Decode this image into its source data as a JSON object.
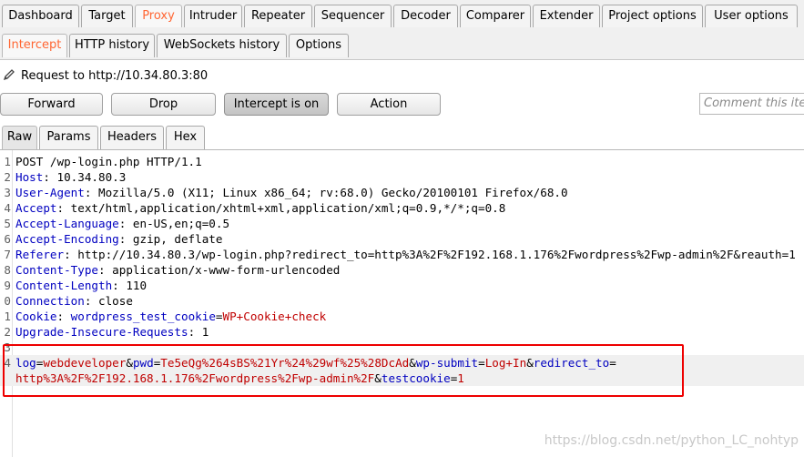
{
  "main_tabs": [
    "Dashboard",
    "Target",
    "Proxy",
    "Intruder",
    "Repeater",
    "Sequencer",
    "Decoder",
    "Comparer",
    "Extender",
    "Project options",
    "User options"
  ],
  "sub_tabs": [
    "Intercept",
    "HTTP history",
    "WebSockets history",
    "Options"
  ],
  "request_to": "Request to http://10.34.80.3:80",
  "buttons": {
    "forward": "Forward",
    "drop": "Drop",
    "intercept": "Intercept is on",
    "action": "Action"
  },
  "comment_placeholder": "Comment this item",
  "view_tabs": [
    "Raw",
    "Params",
    "Headers",
    "Hex"
  ],
  "request_lines": [
    {
      "n": "1",
      "segs": [
        {
          "t": "POST /wp-login.php HTTP/1.1",
          "c": ""
        }
      ]
    },
    {
      "n": "2",
      "segs": [
        {
          "t": "Host",
          "c": "k"
        },
        {
          "t": ": 10.34.80.3",
          "c": ""
        }
      ]
    },
    {
      "n": "3",
      "segs": [
        {
          "t": "User-Agent",
          "c": "k"
        },
        {
          "t": ": Mozilla/5.0 (X11; Linux x86_64; rv:68.0) Gecko/20100101 Firefox/68.0",
          "c": ""
        }
      ]
    },
    {
      "n": "4",
      "segs": [
        {
          "t": "Accept",
          "c": "k"
        },
        {
          "t": ": text/html,application/xhtml+xml,application/xml;q=0.9,*/*;q=0.8",
          "c": ""
        }
      ]
    },
    {
      "n": "5",
      "segs": [
        {
          "t": "Accept-Language",
          "c": "k"
        },
        {
          "t": ": en-US,en;q=0.5",
          "c": ""
        }
      ]
    },
    {
      "n": "6",
      "segs": [
        {
          "t": "Accept-Encoding",
          "c": "k"
        },
        {
          "t": ": gzip, deflate",
          "c": ""
        }
      ]
    },
    {
      "n": "7",
      "segs": [
        {
          "t": "Referer",
          "c": "k"
        },
        {
          "t": ": http://10.34.80.3/wp-login.php?redirect_to=http%3A%2F%2F192.168.1.176%2Fwordpress%2Fwp-admin%2F&reauth=1",
          "c": ""
        }
      ]
    },
    {
      "n": "8",
      "segs": [
        {
          "t": "Content-Type",
          "c": "k"
        },
        {
          "t": ": application/x-www-form-urlencoded",
          "c": ""
        }
      ]
    },
    {
      "n": "9",
      "segs": [
        {
          "t": "Content-Length",
          "c": "k"
        },
        {
          "t": ": 110",
          "c": ""
        }
      ]
    },
    {
      "n": "0",
      "segs": [
        {
          "t": "Connection",
          "c": "k"
        },
        {
          "t": ": close",
          "c": ""
        }
      ]
    },
    {
      "n": "1",
      "segs": [
        {
          "t": "Cookie",
          "c": "k"
        },
        {
          "t": ": ",
          "c": ""
        },
        {
          "t": "wordpress_test_cookie",
          "c": "k"
        },
        {
          "t": "=",
          "c": ""
        },
        {
          "t": "WP+Cookie+check",
          "c": "v"
        }
      ]
    },
    {
      "n": "2",
      "segs": [
        {
          "t": "Upgrade-Insecure-Requests",
          "c": "k"
        },
        {
          "t": ": 1",
          "c": ""
        }
      ]
    },
    {
      "n": "3",
      "segs": []
    },
    {
      "n": "4",
      "segs": [
        {
          "t": "log",
          "c": "k"
        },
        {
          "t": "=",
          "c": ""
        },
        {
          "t": "webdeveloper",
          "c": "v"
        },
        {
          "t": "&",
          "c": ""
        },
        {
          "t": "pwd",
          "c": "k"
        },
        {
          "t": "=",
          "c": ""
        },
        {
          "t": "Te5eQg%264sBS%21Yr%24%29wf%25%28DcAd",
          "c": "v"
        },
        {
          "t": "&",
          "c": ""
        },
        {
          "t": "wp-submit",
          "c": "k"
        },
        {
          "t": "=",
          "c": ""
        },
        {
          "t": "Log+In",
          "c": "v"
        },
        {
          "t": "&",
          "c": ""
        },
        {
          "t": "redirect_to",
          "c": "k"
        },
        {
          "t": "=",
          "c": ""
        }
      ]
    },
    {
      "n": "",
      "segs": [
        {
          "t": "http%3A%2F%2F192.168.1.176%2Fwordpress%2Fwp-admin%2F",
          "c": "v"
        },
        {
          "t": "&",
          "c": ""
        },
        {
          "t": "testcookie",
          "c": "k"
        },
        {
          "t": "=",
          "c": ""
        },
        {
          "t": "1",
          "c": "v"
        }
      ]
    }
  ],
  "watermark": "https://blog.csdn.net/python_LC_nohtyp"
}
